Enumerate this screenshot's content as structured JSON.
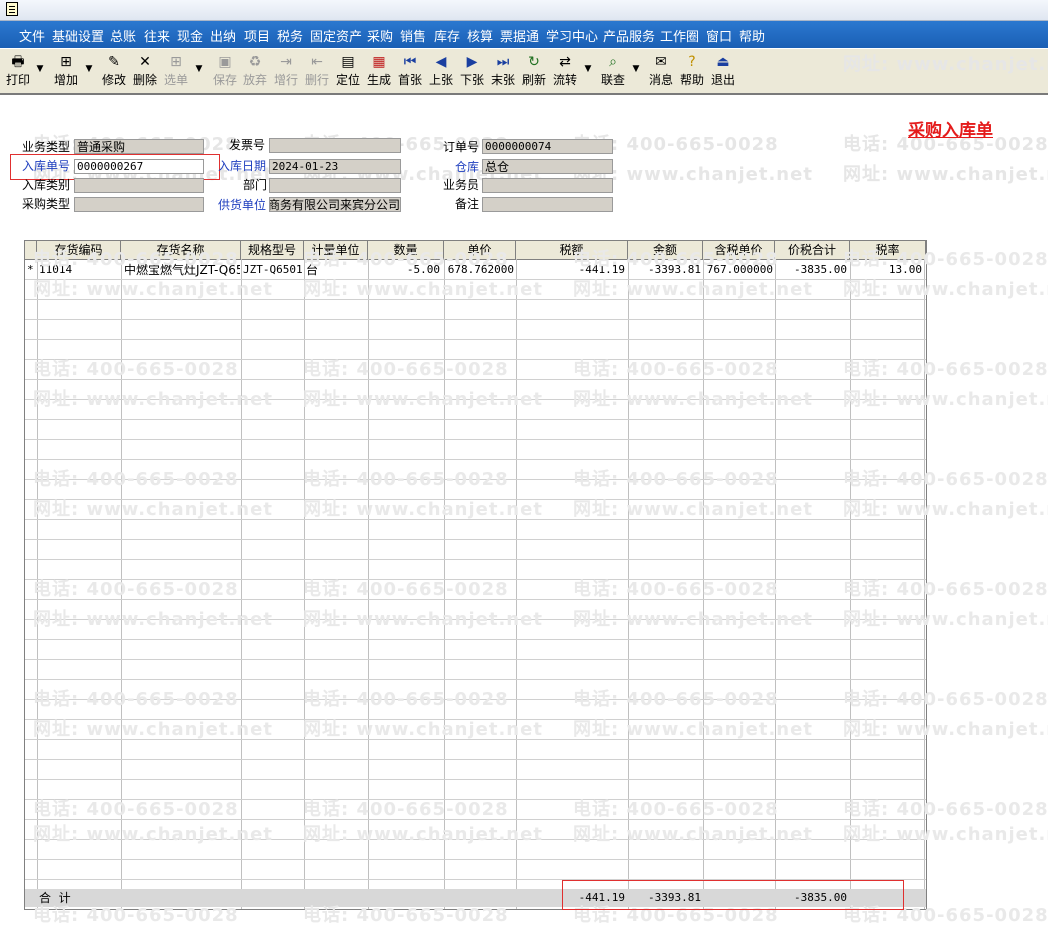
{
  "menu": [
    "文件",
    "基础设置",
    "总账",
    "往来",
    "现金",
    "出纳",
    "项目",
    "税务",
    "固定资产",
    "采购",
    "销售",
    "库存",
    "核算",
    "票据通",
    "学习中心",
    "产品服务",
    "工作圈",
    "窗口",
    "帮助"
  ],
  "toolbar": [
    {
      "label": "打印",
      "icon": "printer-icon",
      "glyph": "🖶",
      "enabled": true
    },
    {
      "label": "增加",
      "icon": "add-icon",
      "glyph": "⊞",
      "enabled": true
    },
    {
      "label": "修改",
      "icon": "edit-icon",
      "glyph": "✎",
      "enabled": true
    },
    {
      "label": "删除",
      "icon": "delete-icon",
      "glyph": "✕",
      "enabled": true
    },
    {
      "label": "选单",
      "icon": "select-order-icon",
      "glyph": "⊞",
      "enabled": false
    },
    {
      "label": "保存",
      "icon": "save-icon",
      "glyph": "▣",
      "enabled": false
    },
    {
      "label": "放弃",
      "icon": "discard-icon",
      "glyph": "♻",
      "enabled": false
    },
    {
      "label": "增行",
      "icon": "add-row-icon",
      "glyph": "⇥",
      "enabled": false
    },
    {
      "label": "删行",
      "icon": "delete-row-icon",
      "glyph": "⇤",
      "enabled": false
    },
    {
      "label": "定位",
      "icon": "locate-icon",
      "glyph": "▤",
      "enabled": true
    },
    {
      "label": "生成",
      "icon": "generate-icon",
      "glyph": "▦",
      "enabled": true
    },
    {
      "label": "首张",
      "icon": "first-icon",
      "glyph": "⏮",
      "enabled": true
    },
    {
      "label": "上张",
      "icon": "prev-icon",
      "glyph": "◀",
      "enabled": true
    },
    {
      "label": "下张",
      "icon": "next-icon",
      "glyph": "▶",
      "enabled": true
    },
    {
      "label": "末张",
      "icon": "last-icon",
      "glyph": "⏭",
      "enabled": true
    },
    {
      "label": "刷新",
      "icon": "refresh-icon",
      "glyph": "↻",
      "enabled": true
    },
    {
      "label": "流转",
      "icon": "flow-icon",
      "glyph": "⇄",
      "enabled": true
    },
    {
      "label": "联查",
      "icon": "query-icon",
      "glyph": "⌕",
      "enabled": true
    },
    {
      "label": "消息",
      "icon": "message-icon",
      "glyph": "✉",
      "enabled": true
    },
    {
      "label": "帮助",
      "icon": "help-icon",
      "glyph": "?",
      "enabled": true
    },
    {
      "label": "退出",
      "icon": "exit-icon",
      "glyph": "⏏",
      "enabled": true
    }
  ],
  "form": {
    "title": "采购入库单",
    "business_type_label": "业务类型",
    "business_type": "普通采购",
    "invoice_no_label": "发票号",
    "invoice_no": "",
    "order_no_label": "订单号",
    "order_no": "0000000074",
    "receipt_no_label": "入库单号",
    "receipt_no": "0000000267",
    "receipt_date_label": "入库日期",
    "receipt_date": "2024-01-23",
    "warehouse_label": "仓库",
    "warehouse": "总仓",
    "receipt_category_label": "入库类别",
    "receipt_category": "",
    "department_label": "部门",
    "department": "",
    "salesman_label": "业务员",
    "salesman": "",
    "purchase_type_label": "采购类型",
    "purchase_type": "",
    "supplier_label": "供货单位",
    "supplier": "商务有限公司来宾分公司",
    "remark_label": "备注",
    "remark": ""
  },
  "table": {
    "headers": [
      "存货编码",
      "存货名称",
      "规格型号",
      "计量单位",
      "数量",
      "单价",
      "税额",
      "金额",
      "含税单价",
      "价税合计",
      "税率"
    ],
    "rows": [
      {
        "marker": "*",
        "code": "11014",
        "name": "中燃宝燃气灶JZT-Q65",
        "spec": "JZT-Q6501E",
        "unit": "台",
        "qty": "-5.00",
        "price": "678.762000",
        "tax": "-441.19",
        "amount": "-3393.81",
        "tax_price": "767.000000",
        "total": "-3835.00",
        "rate": "13.00"
      }
    ],
    "total_label": "合  计",
    "total_tax": "-441.19",
    "total_amount": "-3393.81",
    "total_sum": "-3835.00"
  },
  "watermark": {
    "phone": "电话: 400-665-0028",
    "site": "网址: www.chanjet.net"
  },
  "colors": {
    "menubar": "#1a5fb4",
    "title_red": "#e41b1b",
    "label_blue": "#1f3fbf"
  }
}
